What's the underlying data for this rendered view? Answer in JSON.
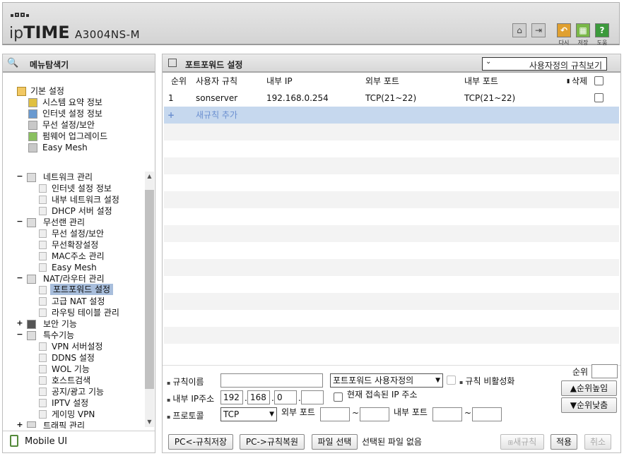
{
  "header": {
    "brand": "ipTIME",
    "brand_prefix": "ip",
    "brand_main": "TIME",
    "model": "A3004NS-M",
    "buttons": [
      {
        "name": "home",
        "label": ""
      },
      {
        "name": "logout",
        "label": ""
      },
      {
        "name": "restart",
        "label": "다시"
      },
      {
        "name": "save",
        "label": "저장"
      },
      {
        "name": "help",
        "label": "도움"
      }
    ],
    "colors": {
      "restart": "#e0a030",
      "save": "#7ab848",
      "help": "#3c9a3c"
    }
  },
  "sidebar": {
    "title": "메뉴탐색기",
    "top_group": {
      "label": "기본 설정",
      "items": [
        "시스템 요약 정보",
        "인터넷 설정 정보",
        "무선 설정/보안",
        "펌웨어 업그레이드",
        "Easy Mesh"
      ]
    },
    "groups": [
      {
        "label": "네트워크 관리",
        "ctl": "−",
        "items": [
          "인터넷 설정 정보",
          "내부 네트워크 설정",
          "DHCP 서버 설정"
        ]
      },
      {
        "label": "무선랜 관리",
        "ctl": "−",
        "items": [
          "무선 설정/보안",
          "무선확장설정",
          "MAC주소 관리",
          "Easy Mesh"
        ]
      },
      {
        "label": "NAT/라우터 관리",
        "ctl": "−",
        "items": [
          "포트포워드 설정",
          "고급 NAT 설정",
          "라우팅 테이블 관리"
        ]
      },
      {
        "label": "보안 기능",
        "ctl": "+",
        "items": []
      },
      {
        "label": "특수기능",
        "ctl": "−",
        "items": [
          "VPN 서버설정",
          "DDNS 설정",
          "WOL 기능",
          "호스트검색",
          "공지/광고 기능",
          "IPTV 설정",
          "게이밍 VPN"
        ]
      },
      {
        "label": "트래픽 관리",
        "ctl": "+",
        "items": []
      }
    ],
    "selected": "포트포워드 설정",
    "mobile_ui": "Mobile UI"
  },
  "main": {
    "title": "포트포워드 설정",
    "view_select": "사용자정의 규칙보기",
    "columns": {
      "no": "순위",
      "name": "사용자 규칙",
      "internal_ip": "내부 IP",
      "external_port": "외부 포트",
      "internal_port": "내부 포트",
      "delete": "삭제"
    },
    "rows": [
      {
        "no": "1",
        "name": "sonserver",
        "internal_ip": "192.168.0.254",
        "external_port": "TCP(21~22)",
        "internal_port": "TCP(21~22)"
      }
    ],
    "add_rule": {
      "plus": "+",
      "label": "새규칙 추가"
    },
    "form": {
      "rule_name_label": "규칙이름",
      "rule_name_value": "",
      "rule_type_select": "포트포워드 사용자정의",
      "disable_label": "규칙 비활성화",
      "priority_label": "순위",
      "priority_value": "",
      "ip_label": "내부 IP주소",
      "ip": [
        "192",
        "168",
        "0",
        ""
      ],
      "current_ip_label": "현재 접속된 IP 주소",
      "priority_up": "▲순위높임",
      "priority_down": "▼순위낮춤",
      "protocol_label": "프로토콜",
      "protocol_value": "TCP",
      "ext_port_label": "외부 포트",
      "int_port_label": "내부 포트",
      "tilde": "~"
    },
    "footer": {
      "save_to_pc": "PC<-규칙저장",
      "restore_from_pc": "PC->규칙복원",
      "file_select": "파일 선택",
      "file_status": "선택된 파일 없음",
      "new_rule": "새규칙",
      "apply": "적용",
      "cancel": "취소"
    }
  }
}
